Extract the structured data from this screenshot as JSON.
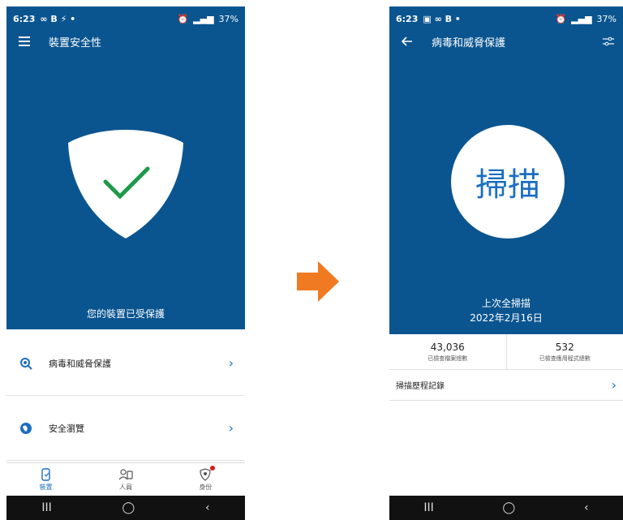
{
  "left": {
    "status": {
      "time": "6:23",
      "left_icons": "∞ B ⚡ •",
      "right_text": "37%"
    },
    "title": "裝置安全性",
    "protected_text": "您的裝置已受保護",
    "items": [
      {
        "label": "病毒和威脅保護",
        "icon": "virus-scan-icon"
      },
      {
        "label": "安全瀏覽",
        "icon": "globe-icon"
      }
    ],
    "nav": [
      {
        "label": "裝置",
        "icon": "device-icon"
      },
      {
        "label": "人員",
        "icon": "people-icon"
      },
      {
        "label": "身份",
        "icon": "identity-icon"
      }
    ]
  },
  "right": {
    "status": {
      "time": "6:23",
      "left_icons": "▣ ∞ B •",
      "right_text": "37%"
    },
    "title": "病毒和威脅保護",
    "scan_label": "掃描",
    "last_scan_label": "上次全掃描",
    "last_scan_date": "2022年2月16日",
    "stats": [
      {
        "value": "43,036",
        "label": "已檢查檔案總數"
      },
      {
        "value": "532",
        "label": "已檢查應用程式總數"
      }
    ],
    "history_label": "掃描歷程記錄"
  },
  "colors": {
    "primary_blue": "#0a5590",
    "accent_blue": "#1a6ec2",
    "check_green": "#1e9a4a",
    "arrow_orange": "#f07a22"
  }
}
